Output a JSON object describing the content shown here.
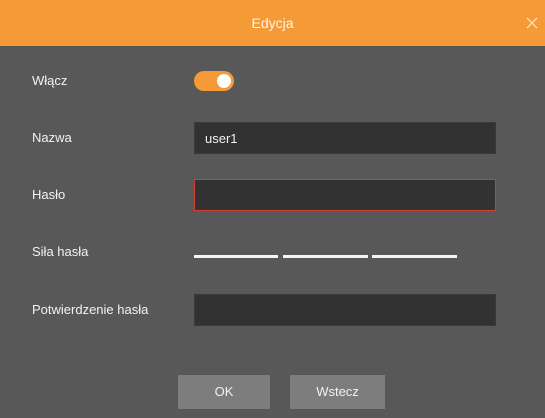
{
  "dialog": {
    "title": "Edycja",
    "close_icon": "close-icon"
  },
  "form": {
    "enable": {
      "label": "Włącz",
      "value": true
    },
    "name": {
      "label": "Nazwa",
      "value": "user1"
    },
    "password": {
      "label": "Hasło",
      "value": ""
    },
    "strength": {
      "label": "Siła hasła",
      "segments": 3
    },
    "confirm": {
      "label": "Potwierdzenie hasła",
      "value": ""
    }
  },
  "buttons": {
    "ok_label": "OK",
    "back_label": "Wstecz"
  },
  "colors": {
    "accent": "#f49a36",
    "background": "#585858",
    "field": "#323232",
    "error_border": "#d43c34",
    "button": "#7d7d7d"
  }
}
